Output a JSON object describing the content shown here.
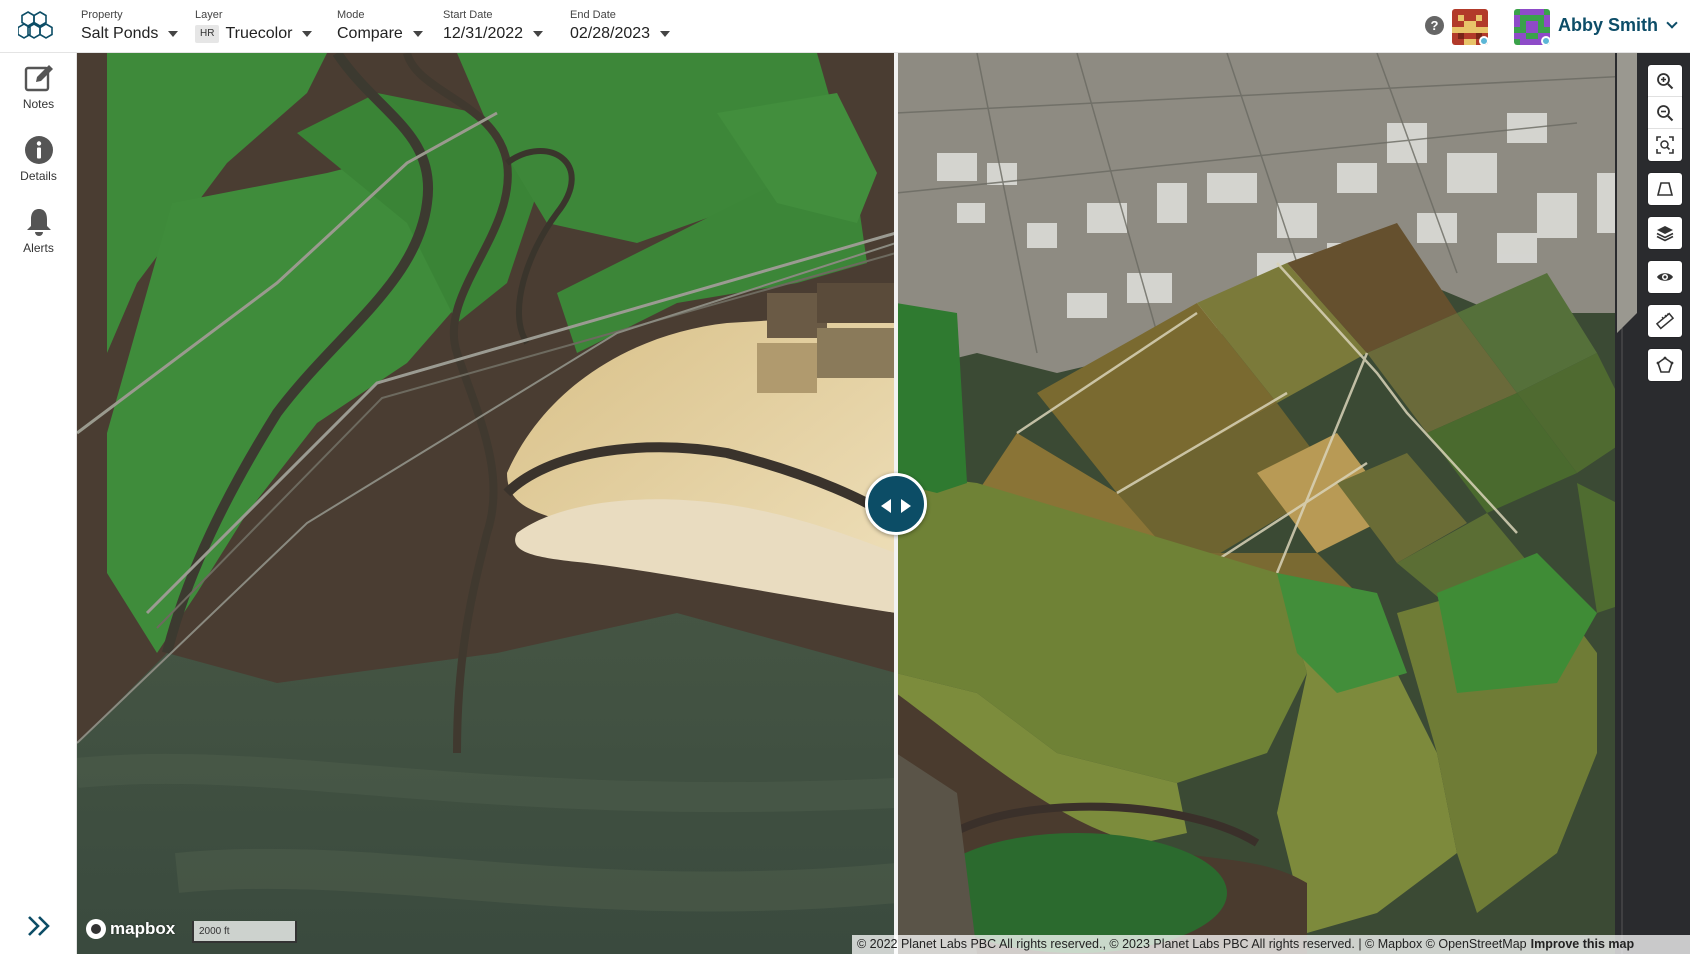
{
  "header": {
    "property": {
      "label": "Property",
      "value": "Salt Ponds"
    },
    "layer": {
      "label": "Layer",
      "badge": "HR",
      "value": "Truecolor"
    },
    "mode": {
      "label": "Mode",
      "value": "Compare"
    },
    "start_date": {
      "label": "Start Date",
      "value": "12/31/2022"
    },
    "end_date": {
      "label": "End Date",
      "value": "02/28/2023"
    },
    "help_glyph": "?",
    "user_name": "Abby Smith"
  },
  "sidebar": {
    "items": [
      {
        "label": "Notes",
        "icon": "edit-icon"
      },
      {
        "label": "Details",
        "icon": "info-icon"
      },
      {
        "label": "Alerts",
        "icon": "bell-icon"
      }
    ],
    "expand_icon": "double-chevron-right-icon"
  },
  "map": {
    "logo_text": "mapbox",
    "scale_label": "2000 ft",
    "attribution": "© 2022 Planet Labs PBC All rights reserved., © 2023 Planet Labs PBC All rights reserved. | © Mapbox © OpenStreetMap",
    "improve_link": "Improve this map",
    "tools": [
      "zoom-in-icon",
      "zoom-out-icon",
      "fit-extent-icon",
      "perspective-icon",
      "layers-icon",
      "visibility-icon",
      "measure-icon",
      "draw-polygon-icon"
    ]
  },
  "colors": {
    "brand": "#0c4d66",
    "marsh_green": "#3f8a3a",
    "mud_brown": "#4b3b30",
    "bay_water": "#3a4d3d",
    "sand": "#e6d3a1"
  }
}
